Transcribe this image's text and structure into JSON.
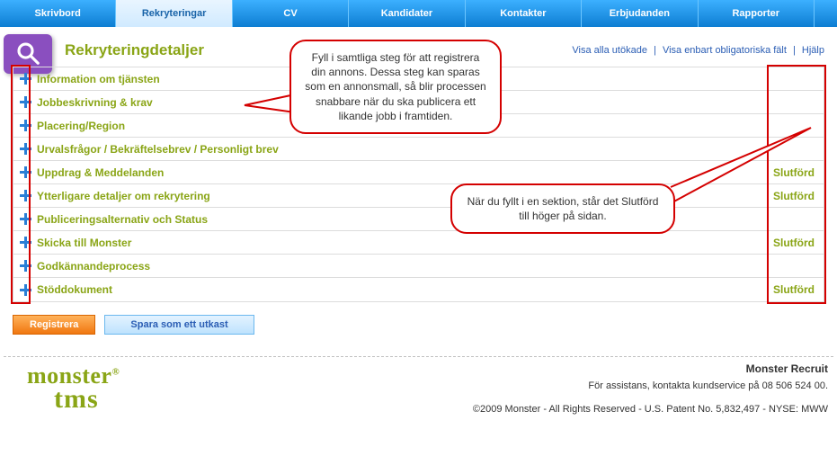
{
  "nav": {
    "tabs": [
      {
        "label": "Skrivbord"
      },
      {
        "label": "Rekryteringar",
        "selected": true
      },
      {
        "label": "CV"
      },
      {
        "label": "Kandidater"
      },
      {
        "label": "Kontakter"
      },
      {
        "label": "Erbjudanden"
      },
      {
        "label": "Rapporter"
      }
    ]
  },
  "header": {
    "title": "Rekryteringdetaljer",
    "links": {
      "expand_all": "Visa alla utökade",
      "required_only": "Visa enbart obligatoriska fält",
      "help": "Hjälp"
    }
  },
  "sections": [
    {
      "title": "Information om tjänsten",
      "status": ""
    },
    {
      "title": "Jobbeskrivning & krav",
      "status": ""
    },
    {
      "title": "Placering/Region",
      "status": ""
    },
    {
      "title": "Urvalsfrågor / Bekräftelsebrev / Personligt brev",
      "status": ""
    },
    {
      "title": "Uppdrag & Meddelanden",
      "status": "Slutförd"
    },
    {
      "title": "Ytterligare detaljer om rekrytering",
      "status": "Slutförd"
    },
    {
      "title": "Publiceringsalternativ och Status",
      "status": ""
    },
    {
      "title": "Skicka till Monster",
      "status": "Slutförd"
    },
    {
      "title": "Godkännandeprocess",
      "status": ""
    },
    {
      "title": "Stöddokument",
      "status": "Slutförd"
    }
  ],
  "buttons": {
    "register": "Registrera",
    "save_draft": "Spara som ett utkast"
  },
  "footer": {
    "logo1": "monster",
    "logo1_reg": "®",
    "logo2": "tms",
    "product": "Monster Recruit",
    "assist": "För assistans, kontakta kundservice på 08 506 524 00.",
    "copyright": "©2009 Monster - All Rights Reserved - U.S. Patent No. 5,832,497 - NYSE: MWW"
  },
  "callouts": {
    "c1": "Fyll i samtliga steg för att registrera din annons. Dessa steg kan sparas som en annonsmall, så blir processen snabbare när du ska publicera ett likande jobb i framtiden.",
    "c2": "När du fyllt i en sektion, står det Slutförd till höger på sidan."
  }
}
